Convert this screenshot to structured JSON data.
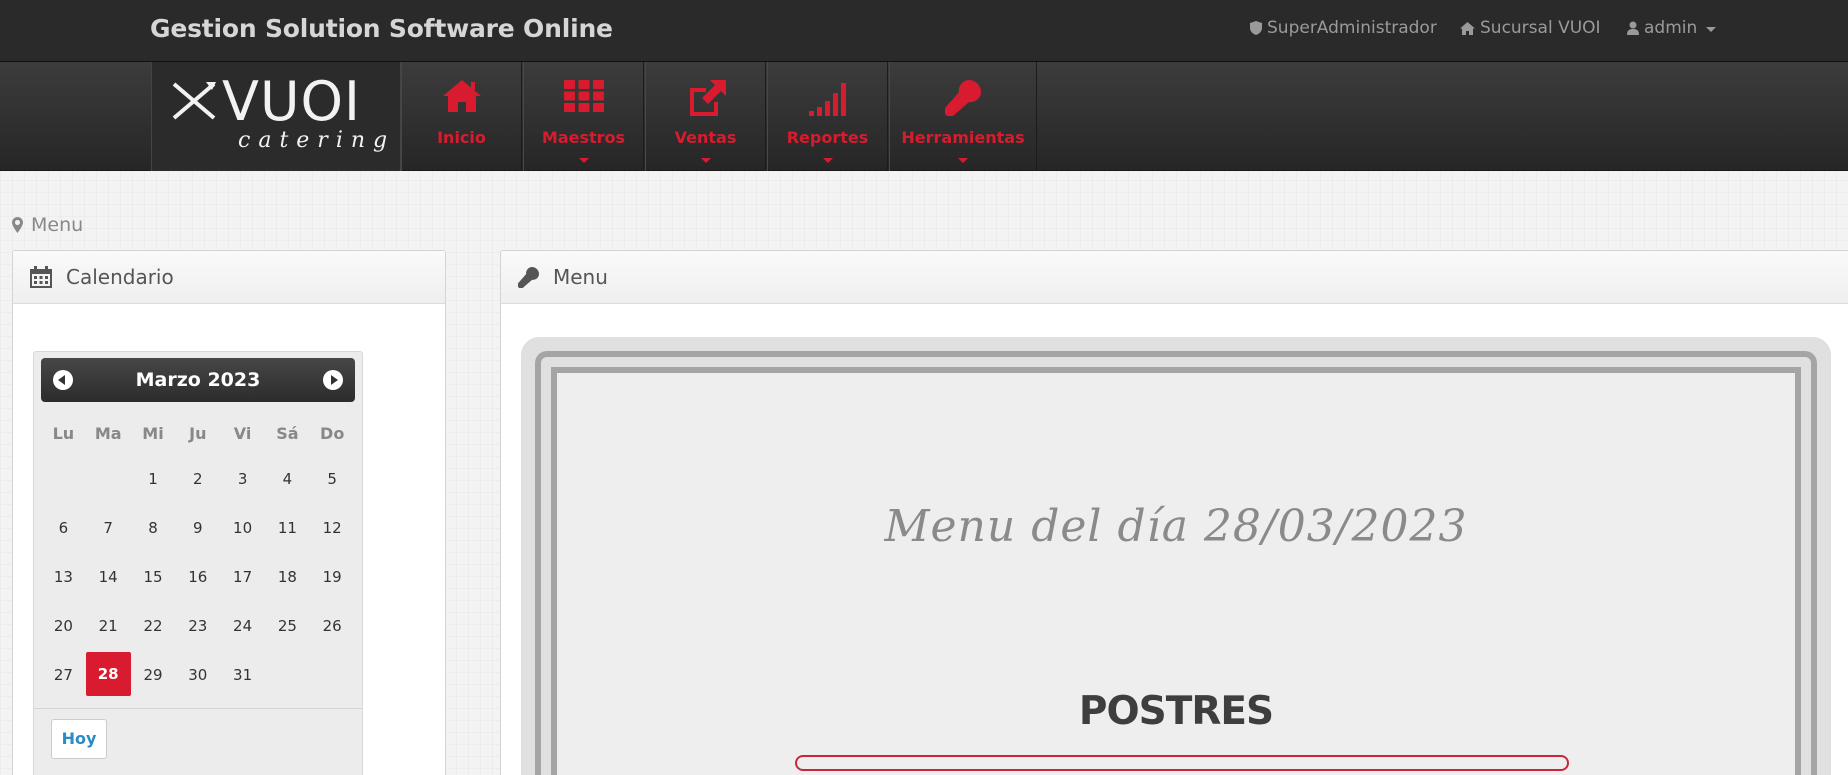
{
  "topbar": {
    "brand": "Gestion Solution Software Online",
    "role": "SuperAdministrador",
    "branch": "Sucursal VUOI",
    "user": "admin"
  },
  "logo": {
    "main": "VUOI",
    "sub": "catering"
  },
  "nav": {
    "items": [
      {
        "label": "Inicio",
        "icon": "home-icon"
      },
      {
        "label": "Maestros",
        "icon": "grid-icon"
      },
      {
        "label": "Ventas",
        "icon": "external-link-icon"
      },
      {
        "label": "Reportes",
        "icon": "signal-bars-icon"
      },
      {
        "label": "Herramientas",
        "icon": "wrench-icon"
      }
    ]
  },
  "breadcrumb": {
    "label": "Menu"
  },
  "calendar_panel": {
    "title": "Calendario",
    "month_title": "Marzo 2023",
    "weekdays": [
      "Lu",
      "Ma",
      "Mi",
      "Ju",
      "Vi",
      "Sá",
      "Do"
    ],
    "weeks": [
      [
        "",
        "",
        "1",
        "2",
        "3",
        "4",
        "5"
      ],
      [
        "6",
        "7",
        "8",
        "9",
        "10",
        "11",
        "12"
      ],
      [
        "13",
        "14",
        "15",
        "16",
        "17",
        "18",
        "19"
      ],
      [
        "20",
        "21",
        "22",
        "23",
        "24",
        "25",
        "26"
      ],
      [
        "27",
        "28",
        "29",
        "30",
        "31",
        "",
        ""
      ]
    ],
    "selected_day": "28",
    "today_button": "Hoy"
  },
  "menu_panel": {
    "title": "Menu",
    "menu_title": "Menu del día 28/03/2023",
    "section": "POSTRES"
  },
  "colors": {
    "accent": "#d81b2f",
    "topbar": "#2a2a2a",
    "link": "#2a8bc7"
  }
}
